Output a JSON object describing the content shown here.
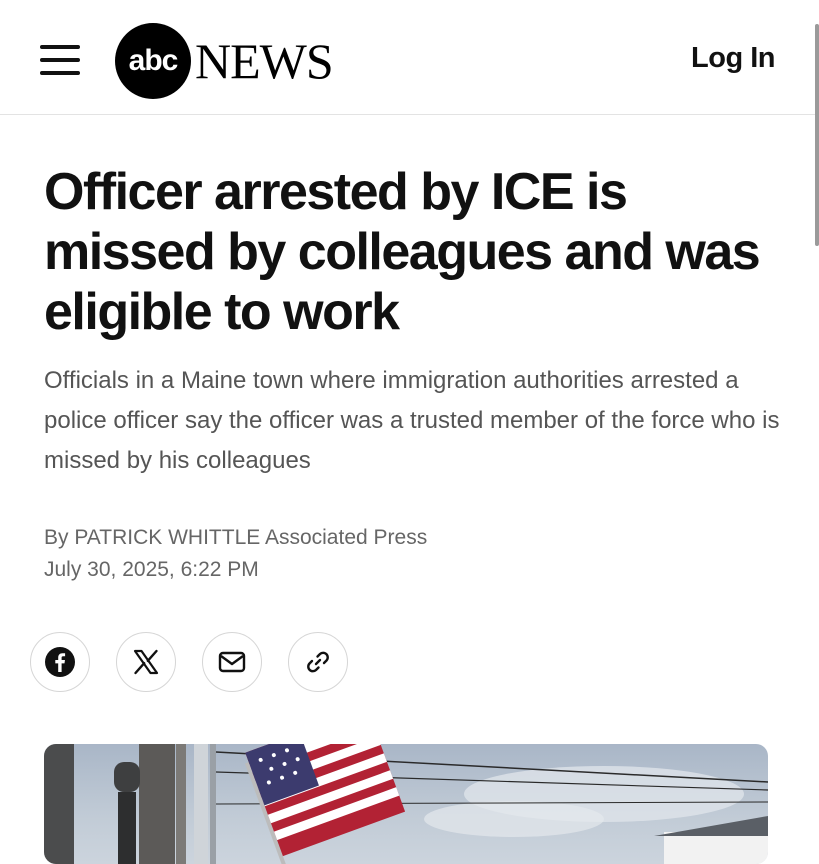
{
  "header": {
    "logo_mark": "abc",
    "logo_text": "NEWS",
    "login_label": "Log In"
  },
  "article": {
    "headline": "Officer arrested by ICE is missed by colleagues and was eligible to work",
    "subheadline": "Officials in a Maine town where immigration authorities arrested a police officer say the officer was a trusted member of the force who is missed by his colleagues",
    "byline_prefix": "By",
    "author": "PATRICK WHITTLE",
    "outlet": "Associated Press",
    "date": "July 30, 2025, 6:22 PM"
  },
  "share": {
    "icons": [
      "facebook-icon",
      "x-icon",
      "email-icon",
      "link-icon"
    ]
  },
  "colors": {
    "text": "#111111",
    "muted": "#555555",
    "border": "#d6d6d6"
  }
}
